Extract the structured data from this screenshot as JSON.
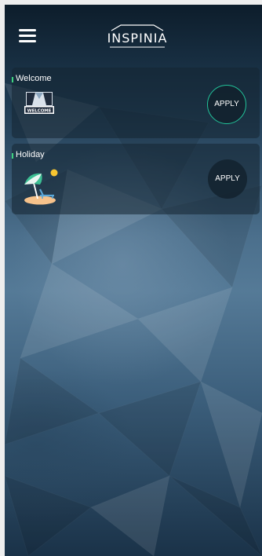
{
  "app": {
    "brand": "INSPINIA"
  },
  "scenes": [
    {
      "title": "Welcome",
      "action_label": "APPLY",
      "icon": "welcome-icon",
      "selected": true
    },
    {
      "title": "Holiday",
      "action_label": "APPLY",
      "icon": "beach-umbrella-icon",
      "selected": false
    }
  ],
  "colors": {
    "accent_green": "#3fd27f",
    "selected_ring": "#22c39a",
    "text": "#ffffff",
    "card_bg": "#142432"
  }
}
